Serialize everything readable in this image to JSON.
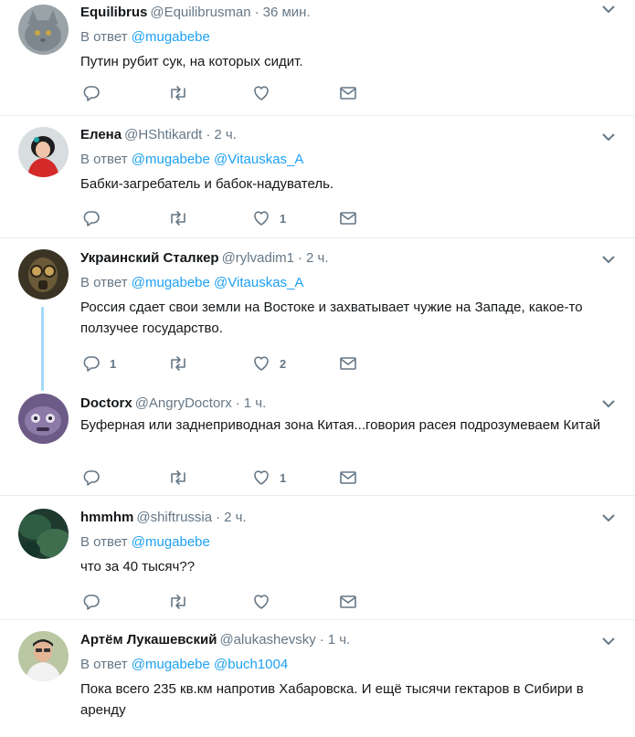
{
  "accent_color": "#1da1f2",
  "reply_prefix": "В ответ",
  "tweets": [
    {
      "name": "Equilibrus",
      "handle": "@Equilibrusman",
      "time": "36 мин.",
      "mentions": [
        "@mugabebe"
      ],
      "text": "Путин рубит сук, на которых сидит.",
      "replies": "",
      "likes": ""
    },
    {
      "name": "Елена",
      "handle": "@HShtikardt",
      "time": "2 ч.",
      "mentions": [
        "@mugabebe",
        "@Vitauskas_A"
      ],
      "text": "Бабки-загребатель и бабок-надуватель.",
      "replies": "",
      "likes": "1"
    },
    {
      "name": "Украинский Сталкер",
      "handle": "@rylvadim1",
      "time": "2 ч.",
      "mentions": [
        "@mugabebe",
        "@Vitauskas_A"
      ],
      "text": "Россия сдает свои земли на Востоке и захватывает чужие на Западе, какое-то ползучее государство.",
      "replies": "1",
      "likes": "2"
    },
    {
      "name": "Doctorx",
      "handle": "@AngryDoctorx",
      "time": "1 ч.",
      "mentions": [],
      "text": "Буферная или заднеприводная зона Китая...говория расея подрозумеваем Китай",
      "replies": "",
      "likes": "1"
    },
    {
      "name": "hmmhm",
      "handle": "@shiftrussia",
      "time": "2 ч.",
      "mentions": [
        "@mugabebe"
      ],
      "text": "что за 40 тысяч??",
      "replies": "",
      "likes": ""
    },
    {
      "name": "Артём Лукашевский",
      "handle": "@alukashevsky",
      "time": "1 ч.",
      "mentions": [
        "@mugabebe",
        "@buch1004"
      ],
      "text": "Пока всего 235 кв.км напротив Хабаровска. И ещё тысячи гектаров в Сибири в аренду",
      "replies": "",
      "likes": ""
    }
  ]
}
